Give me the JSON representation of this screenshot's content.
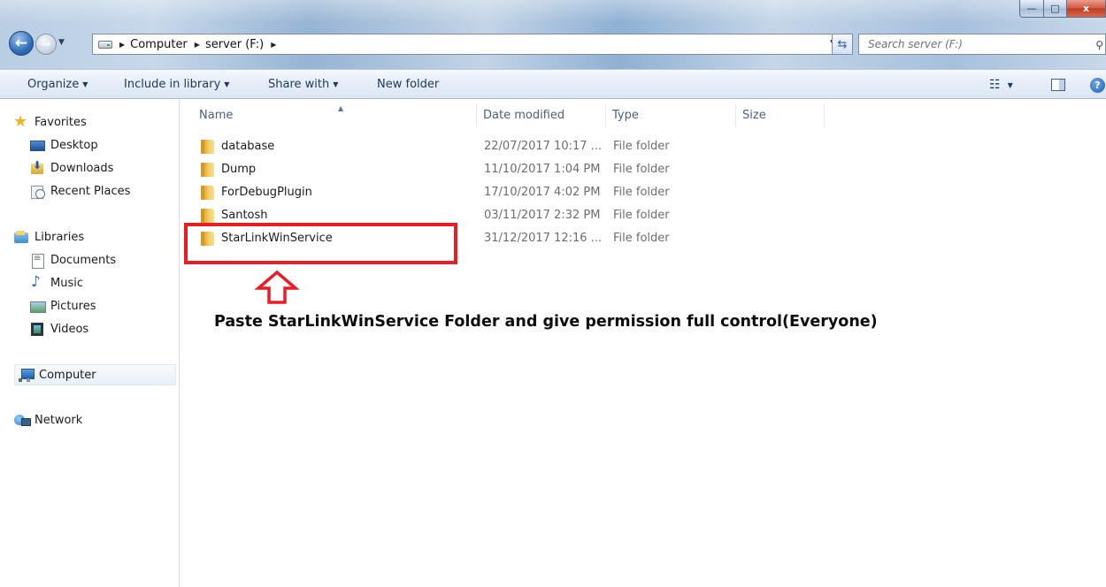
{
  "window": {
    "minimize_glyph": "—",
    "maximize_glyph": "□",
    "close_glyph": "x"
  },
  "address": {
    "crumbs": [
      "Computer",
      "server (F:)"
    ],
    "search_placeholder": "Search server (F:)"
  },
  "toolbar": {
    "organize": "Organize",
    "include_in_library": "Include in library",
    "share_with": "Share with",
    "new_folder": "New folder",
    "help": "?"
  },
  "nav": {
    "favorites": "Favorites",
    "desktop": "Desktop",
    "downloads": "Downloads",
    "recent_places": "Recent Places",
    "libraries": "Libraries",
    "documents": "Documents",
    "music": "Music",
    "pictures": "Pictures",
    "videos": "Videos",
    "computer": "Computer",
    "network": "Network"
  },
  "columns": {
    "name": "Name",
    "date_modified": "Date modified",
    "type": "Type",
    "size": "Size"
  },
  "files": [
    {
      "name": "database",
      "date": "22/07/2017 10:17 ...",
      "type": "File folder"
    },
    {
      "name": "Dump",
      "date": "11/10/2017 1:04 PM",
      "type": "File folder"
    },
    {
      "name": "ForDebugPlugin",
      "date": "17/10/2017 4:02 PM",
      "type": "File folder"
    },
    {
      "name": "Santosh",
      "date": "03/11/2017 2:32 PM",
      "type": "File folder"
    },
    {
      "name": "StarLinkWinService",
      "date": "31/12/2017 12:16 ...",
      "type": "File folder"
    }
  ],
  "annotation": {
    "text": "Paste StarLinkWinService Folder and give permission full control(Everyone)",
    "color": "#ec1c24"
  }
}
